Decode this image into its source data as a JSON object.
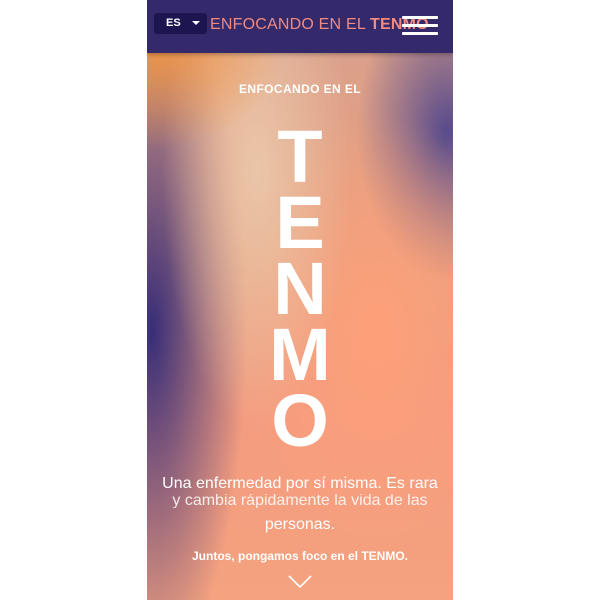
{
  "header": {
    "language": "ES",
    "brand_prefix": "ENFOCANDO EN EL ",
    "brand_strong": "TENMO",
    "menu_icon": "hamburger-icon"
  },
  "hero": {
    "kicker": "ENFOCANDO EN EL",
    "letters": [
      "T",
      "E",
      "N",
      "M",
      "O"
    ],
    "tagline_line1": "Una enfermedad por sí misma. Es rara",
    "tagline_line2": "y cambia rápidamente la vida de las",
    "tagline_line3": "personas.",
    "cta": "Juntos, pongamos foco en el TENMO.",
    "scroll_icon": "chevron-down-icon"
  },
  "colors": {
    "header_bg": "#33296b",
    "brand_accent": "#f08a82",
    "select_bg": "#1c1550"
  }
}
